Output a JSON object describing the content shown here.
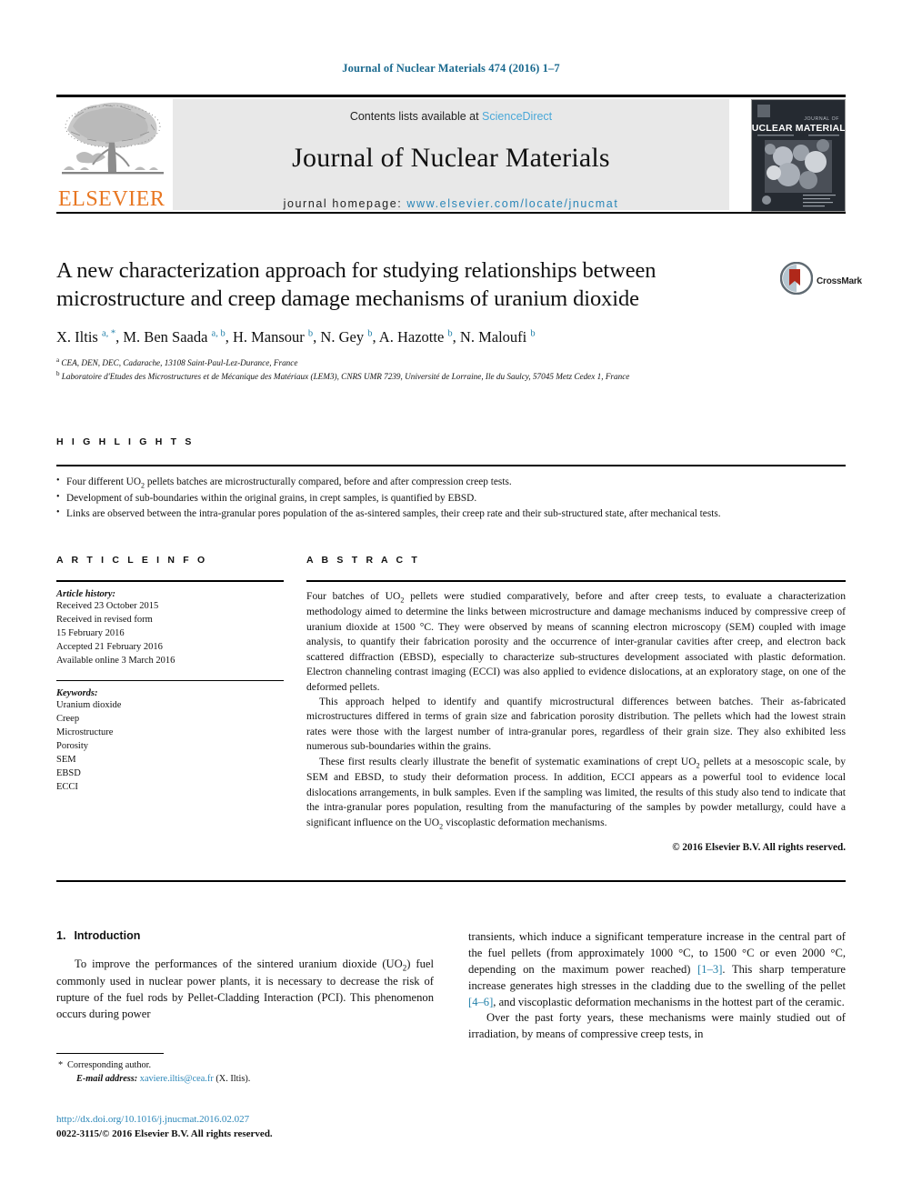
{
  "running_head": "Journal of Nuclear Materials 474 (2016) 1–7",
  "masthead": {
    "publisher_logo_label": "ELSEVIER",
    "contents_prefix": "Contents lists available at ",
    "contents_link": "ScienceDirect",
    "journal_title": "Journal of Nuclear Materials",
    "homepage_prefix": "journal homepage: ",
    "homepage_url": "www.elsevier.com/locate/jnucmat",
    "cover_title_small": "JOURNAL OF",
    "cover_title_big": "NUCLEAR MATERIALS"
  },
  "article": {
    "title": "A new characterization approach for studying relationships between microstructure and creep damage mechanisms of uranium dioxide",
    "crossmark_label": "CrossMark",
    "authors": [
      {
        "name": "X. Iltis",
        "marks": "a, *"
      },
      {
        "name": "M. Ben Saada",
        "marks": "a, b"
      },
      {
        "name": "H. Mansour",
        "marks": "b"
      },
      {
        "name": "N. Gey",
        "marks": "b"
      },
      {
        "name": "A. Hazotte",
        "marks": "b"
      },
      {
        "name": "N. Maloufi",
        "marks": "b"
      }
    ],
    "affiliations": [
      {
        "mark": "a",
        "text": "CEA, DEN, DEC, Cadarache, 13108 Saint-Paul-Lez-Durance, France"
      },
      {
        "mark": "b",
        "text": "Laboratoire d'Etudes des Microstructures et de Mécanique des Matériaux (LEM3), CNRS UMR 7239, Université de Lorraine, Ile du Saulcy, 57045 Metz Cedex 1, France"
      }
    ]
  },
  "highlights": {
    "heading": "H I G H L I G H T S",
    "items": [
      "Four different UO2 pellets batches are microstructurally compared, before and after compression creep tests.",
      "Development of sub-boundaries within the original grains, in crept samples, is quantified by EBSD.",
      "Links are observed between the intra-granular pores population of the as-sintered samples, their creep rate and their sub-structured state, after mechanical tests."
    ]
  },
  "article_info": {
    "heading": "A R T I C L E   I N F O",
    "history_title": "Article history:",
    "history_lines": [
      "Received 23 October 2015",
      "Received in revised form",
      "15 February 2016",
      "Accepted 21 February 2016",
      "Available online 3 March 2016"
    ],
    "keywords_title": "Keywords:",
    "keywords": [
      "Uranium dioxide",
      "Creep",
      "Microstructure",
      "Porosity",
      "SEM",
      "EBSD",
      "ECCI"
    ]
  },
  "abstract": {
    "heading": "A B S T R A C T",
    "paragraphs": [
      "Four batches of UO2 pellets were studied comparatively, before and after creep tests, to evaluate a characterization methodology aimed to determine the links between microstructure and damage mechanisms induced by compressive creep of uranium dioxide at 1500 °C. They were observed by means of scanning electron microscopy (SEM) coupled with image analysis, to quantify their fabrication porosity and the occurrence of inter-granular cavities after creep, and electron back scattered diffraction (EBSD), especially to characterize sub-structures development associated with plastic deformation. Electron channeling contrast imaging (ECCI) was also applied to evidence dislocations, at an exploratory stage, on one of the deformed pellets.",
      "This approach helped to identify and quantify microstructural differences between batches. Their as-fabricated microstructures differed in terms of grain size and fabrication porosity distribution. The pellets which had the lowest strain rates were those with the largest number of intra-granular pores, regardless of their grain size. They also exhibited less numerous sub-boundaries within the grains.",
      "These first results clearly illustrate the benefit of systematic examinations of crept UO2 pellets at a mesoscopic scale, by SEM and EBSD, to study their deformation process. In addition, ECCI appears as a powerful tool to evidence local dislocations arrangements, in bulk samples. Even if the sampling was limited, the results of this study also tend to indicate that the intra-granular pores population, resulting from the manufacturing of the samples by powder metallurgy, could have a significant influence on the UO2 viscoplastic deformation mechanisms."
    ],
    "copyright": "© 2016 Elsevier B.V. All rights reserved."
  },
  "introduction": {
    "number": "1.",
    "title": "Introduction",
    "left_paragraph": "To improve the performances of the sintered uranium dioxide (UO2) fuel commonly used in nuclear power plants, it is necessary to decrease the risk of rupture of the fuel rods by Pellet-Cladding Interaction (PCI). This phenomenon occurs during power",
    "right_paragraph_1_a": "transients, which induce a significant temperature increase in the central part of the fuel pellets (from approximately 1000 °C, to 1500 °C or even 2000 °C, depending on the maximum power reached) ",
    "right_ref_1": "[1–3]",
    "right_paragraph_1_b": ". This sharp temperature increase generates high stresses in the cladding due to the swelling of the pellet ",
    "right_ref_2": "[4–6]",
    "right_paragraph_1_c": ", and viscoplastic deformation mechanisms in the hottest part of the ceramic.",
    "right_paragraph_2": "Over the past forty years, these mechanisms were mainly studied out of irradiation, by means of compressive creep tests, in"
  },
  "footer": {
    "corresponding_star": "*",
    "corresponding_label": "Corresponding author.",
    "email_label": "E-mail address:",
    "email": "xaviere.iltis@cea.fr",
    "email_owner": "(X. Iltis).",
    "doi": "http://dx.doi.org/10.1016/j.jnucmat.2016.02.027",
    "issn_line": "0022-3115/© 2016 Elsevier B.V. All rights reserved."
  },
  "colors": {
    "link": "#2a86b8",
    "running_head": "#1b6a8f",
    "elsevier_orange": "#E87722",
    "banner_gray": "#e8e8e8",
    "crossmark_red": "#b0281a"
  }
}
